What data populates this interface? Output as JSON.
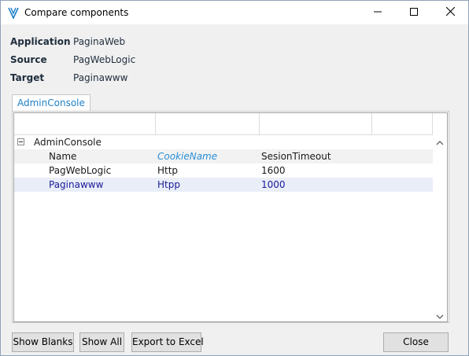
{
  "window": {
    "title": "Compare components",
    "colors": {
      "accent": "#1e7fc8",
      "frame": "#f0f0f0"
    },
    "icons": {
      "app": "app-logo-icon",
      "minimize": "minimize-icon",
      "maximize": "maximize-icon",
      "close": "close-icon"
    }
  },
  "info": {
    "application_label": "Application",
    "application_value": "PaginaWeb",
    "source_label": "Source",
    "source_value": "PagWebLogic",
    "target_label": "Target",
    "target_value": "Paginawww"
  },
  "tabs": [
    {
      "label": "AdminConsole",
      "selected": true
    }
  ],
  "grid": {
    "group": {
      "label": "AdminConsole",
      "expanded": true
    },
    "columns": [
      "Name",
      "CookieName",
      "SesionTimeout"
    ],
    "rows": [
      {
        "name": "PagWebLogic",
        "cookie": "Http",
        "timeout": "1600"
      },
      {
        "name": "Paginawww",
        "cookie": "Htpp",
        "timeout": "1000"
      }
    ]
  },
  "buttons": {
    "show_blanks": "Show Blanks",
    "show_all": "Show All",
    "export_excel": "Export to Excel",
    "close": "Close"
  }
}
